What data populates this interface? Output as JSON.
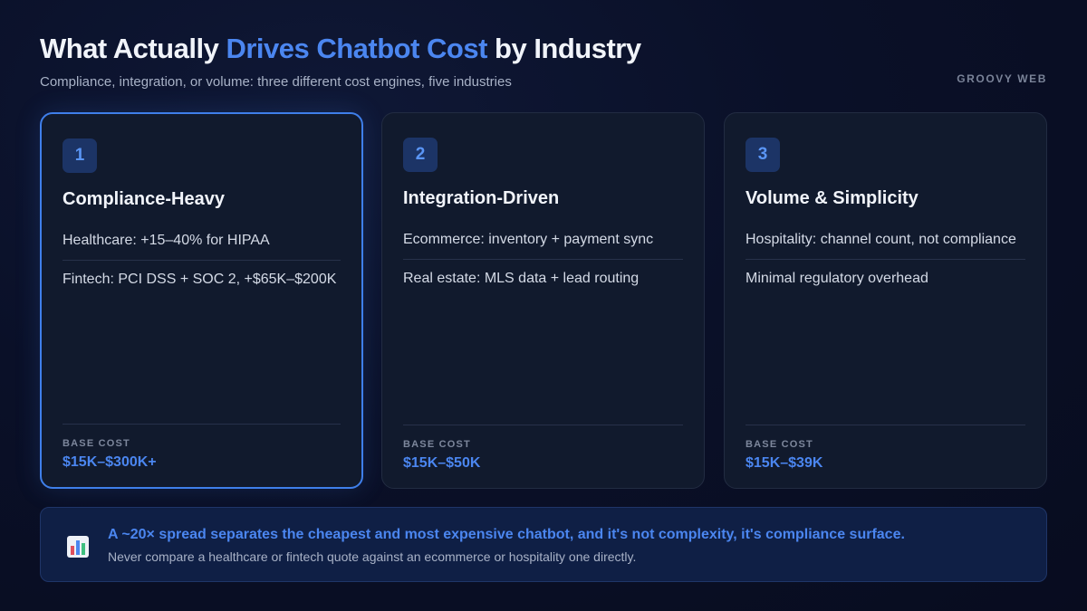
{
  "header": {
    "title_pre": "What Actually ",
    "title_accent": "Drives Chatbot Cost",
    "title_post": " by Industry",
    "subtitle": "Compliance, integration, or volume: three different cost engines, five industries",
    "brand": "GROOVY WEB"
  },
  "cards": [
    {
      "number": "1",
      "name": "Compliance-Heavy",
      "points": [
        "Healthcare: +15–40% for HIPAA",
        "Fintech: PCI DSS + SOC 2, +$65K–$200K"
      ],
      "base_label": "BASE COST",
      "base_value": "$15K–$300K+"
    },
    {
      "number": "2",
      "name": "Integration-Driven",
      "points": [
        "Ecommerce: inventory + payment sync",
        "Real estate: MLS data + lead routing"
      ],
      "base_label": "BASE COST",
      "base_value": "$15K–$50K"
    },
    {
      "number": "3",
      "name": "Volume & Simplicity",
      "points": [
        "Hospitality: channel count, not compliance",
        "Minimal regulatory overhead"
      ],
      "base_label": "BASE COST",
      "base_value": "$15K–$39K"
    }
  ],
  "callout": {
    "icon": "bar-chart-icon",
    "headline": "A ~20× spread separates the cheapest and most expensive chatbot, and it's not complexity, it's compliance surface.",
    "subtext": "Never compare a healthcare or fintech quote against an ecommerce or hospitality one directly."
  },
  "colors": {
    "accent": "#4b86f0",
    "background": "#0a1028",
    "card": "#111a2d",
    "active_border": "#3f7fea"
  }
}
